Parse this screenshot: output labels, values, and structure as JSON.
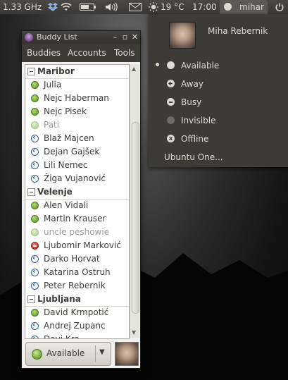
{
  "panel": {
    "cpu_freq": "1.33 GHz",
    "weather_temp": "19 °C",
    "clock": "17:00",
    "user": "mihar"
  },
  "me_menu": {
    "name": "Miha Rebernik",
    "statuses": [
      {
        "label": "Available",
        "icon": "available-icon",
        "selected": true
      },
      {
        "label": "Away",
        "icon": "away-icon",
        "selected": false
      },
      {
        "label": "Busy",
        "icon": "busy-icon",
        "selected": false
      },
      {
        "label": "Invisible",
        "icon": "invisible-icon",
        "selected": false
      },
      {
        "label": "Offline",
        "icon": "offline-icon",
        "selected": false
      }
    ],
    "ubuntu_one": "Ubuntu One..."
  },
  "window": {
    "title": "Buddy List",
    "menu": {
      "buddies": "Buddies",
      "accounts": "Accounts",
      "tools": "Tools"
    }
  },
  "buddy_list": [
    {
      "type": "group",
      "name": "Maribor"
    },
    {
      "type": "buddy",
      "name": "Julia",
      "status": "available"
    },
    {
      "type": "buddy",
      "name": "Nejc Haberman",
      "status": "available"
    },
    {
      "type": "buddy",
      "name": "Nejc Pisek",
      "status": "available"
    },
    {
      "type": "buddy",
      "name": "Pati",
      "status": "idle"
    },
    {
      "type": "buddy",
      "name": "Blaž Majcen",
      "status": "away"
    },
    {
      "type": "buddy",
      "name": "Dejan Gajšek",
      "status": "away"
    },
    {
      "type": "buddy",
      "name": "Lili Nemec",
      "status": "away"
    },
    {
      "type": "buddy",
      "name": "Žiga Vujanović",
      "status": "away"
    },
    {
      "type": "group",
      "name": "Velenje"
    },
    {
      "type": "buddy",
      "name": "Alen Vidali",
      "status": "available"
    },
    {
      "type": "buddy",
      "name": "Martin Krauser",
      "status": "available"
    },
    {
      "type": "buddy",
      "name": "uncle peshowie",
      "status": "idle"
    },
    {
      "type": "buddy",
      "name": "Ljubomir Marković",
      "status": "busy"
    },
    {
      "type": "buddy",
      "name": "Darko Horvat",
      "status": "away"
    },
    {
      "type": "buddy",
      "name": "Katarina Ostruh",
      "status": "away"
    },
    {
      "type": "buddy",
      "name": "Peter Rebernik",
      "status": "away"
    },
    {
      "type": "group",
      "name": "Ljubljana"
    },
    {
      "type": "buddy",
      "name": "David Krmpotić",
      "status": "available"
    },
    {
      "type": "buddy",
      "name": "Andrej Zupanc",
      "status": "away"
    },
    {
      "type": "buddy",
      "name": "Davi Kra",
      "status": "away"
    }
  ],
  "status_selector": {
    "label": "Available"
  }
}
